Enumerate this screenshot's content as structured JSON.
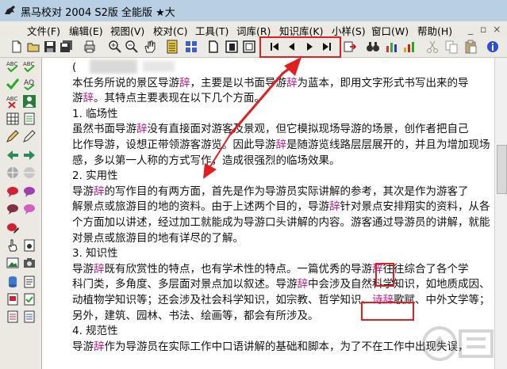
{
  "window": {
    "title": "黑马校对 2004   S2版   全能版          ★大"
  },
  "menu": [
    {
      "label": "文件(F)"
    },
    {
      "label": "编辑(E)"
    },
    {
      "label": "视图(V)"
    },
    {
      "label": "校对(C)"
    },
    {
      "label": "工具(T)"
    },
    {
      "label": "词库(R)"
    },
    {
      "label": "知识库(K)"
    },
    {
      "label": "小样(S)"
    },
    {
      "label": "窗口(W)"
    },
    {
      "label": "帮助(H)"
    }
  ],
  "toolbar_icons": [
    "new-doc-icon",
    "open-folder-icon",
    "save-icon",
    "save-all-icon",
    "print-icon",
    "zoom-in-icon",
    "zoom-out-icon",
    "hand-icon",
    "notes-icon",
    "grid-icon",
    "page-icon",
    "page-double-icon",
    "page-multi-icon",
    "first-icon",
    "prev-icon",
    "next-icon",
    "last-icon",
    "export-icon",
    "find-icon",
    "chart-icon",
    "bar-icon",
    "cut-icon",
    "copy-icon",
    "paste-icon"
  ],
  "document": {
    "lines": [
      {
        "segments": [
          {
            "t": "("
          }
        ]
      },
      {
        "segments": [
          {
            "t": "    本任务所说的景区导游"
          },
          {
            "t": "辞",
            "hl": true
          },
          {
            "t": "，主要是以书面导游"
          },
          {
            "t": "辞",
            "hl": true
          },
          {
            "t": "为蓝本，即用文字形式书写出来的导"
          }
        ]
      },
      {
        "segments": [
          {
            "t": "游"
          },
          {
            "t": "辞",
            "hl": true
          },
          {
            "t": "。其特点主要表现在以下几个方面。"
          }
        ]
      },
      {
        "segments": [
          {
            "t": "    1. 临场性"
          }
        ]
      },
      {
        "segments": [
          {
            "t": "    虽然书面导游"
          },
          {
            "t": "辞",
            "hl": true
          },
          {
            "t": "没有直接面对游客及景观，但它模拟现场导游的场景，创作者把自己"
          }
        ]
      },
      {
        "segments": [
          {
            "t": "比作导游，设想正带领游客游览。因此导游"
          },
          {
            "t": "辞",
            "hl": true
          },
          {
            "t": "是随游览线路层层展开的，并且为增加现场"
          }
        ]
      },
      {
        "segments": [
          {
            "t": "感，多以第一人称的方式写作，造成很强烈的临场效果。"
          }
        ]
      },
      {
        "segments": [
          {
            "t": "    2. 实用性"
          }
        ]
      },
      {
        "segments": [
          {
            "t": "    导游"
          },
          {
            "t": "辞",
            "hl": true
          },
          {
            "t": "的写作目的有两方面，首先是作为导游员实际讲解的参考，其次是作为游客了"
          }
        ]
      },
      {
        "segments": [
          {
            "t": "解景点或旅游目的地的资料。由于上述两个目的，导游"
          },
          {
            "t": "辞",
            "hl": true
          },
          {
            "t": "针对景点安排翔实的资料，从各"
          }
        ]
      },
      {
        "segments": [
          {
            "t": "个方面加以讲述，经过加工就能成为导游口头讲解的内容。游客通过导游员的讲解，就能"
          }
        ]
      },
      {
        "segments": [
          {
            "t": "对景点或旅游目的地有详尽的了解。"
          }
        ]
      },
      {
        "segments": [
          {
            "t": "    3. 知识性"
          }
        ]
      },
      {
        "segments": [
          {
            "t": "    导游"
          },
          {
            "t": "辞",
            "hl": true
          },
          {
            "t": "既有欣赏性的特点，也有学术性的特点。一篇优秀的导游"
          },
          {
            "t": "辞",
            "hl": true
          },
          {
            "t": "往往综合了各个学"
          }
        ]
      },
      {
        "segments": [
          {
            "t": "科门类，多角度、多层面对景点加以叙述。导游"
          },
          {
            "t": "辞",
            "hl": true
          },
          {
            "t": "中会涉及自然科学知识，如地质成因、"
          }
        ]
      },
      {
        "segments": [
          {
            "t": "动植物学知识等；还会涉及社会科学知识，如宗教、哲学知识、"
          },
          {
            "t": "诗辞",
            "hl": true
          },
          {
            "t": "歌赋、中外文学等；"
          }
        ]
      },
      {
        "segments": [
          {
            "t": "另外，建筑、园林、书法、绘画等，都会有所涉及。"
          }
        ]
      },
      {
        "segments": [
          {
            "t": "    4. 规范性"
          }
        ]
      },
      {
        "segments": [
          {
            "t": "    导游"
          },
          {
            "t": "辞",
            "hl": true
          },
          {
            "t": "作为导游员在实际工作中口语讲解的基础和脚本，为了不在工作中出现失误，"
          }
        ]
      }
    ]
  },
  "colors": {
    "highlight": "#c0208e",
    "annotation_red": "#e02020",
    "arrow_red": "#e02020"
  }
}
